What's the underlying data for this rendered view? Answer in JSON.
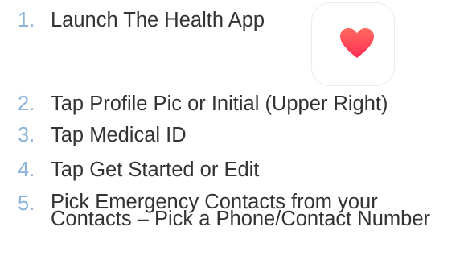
{
  "steps": [
    {
      "number": "1.",
      "text": "Launch The Health App"
    },
    {
      "number": "2.",
      "text": "Tap Profile Pic or Initial (Upper Right)"
    },
    {
      "number": "3.",
      "text": "Tap Medical ID"
    },
    {
      "number": "4.",
      "text": "Tap Get Started or Edit"
    },
    {
      "number": "5.",
      "text": "Pick Emergency Contacts from your Contacts – Pick a Phone/Contact Number"
    }
  ],
  "colors": {
    "number": "#8cb3d9",
    "text": "#333333",
    "heart_top": "#ff6a5e",
    "heart_bottom": "#ff2d55"
  },
  "icon": {
    "name": "health-app-heart-icon"
  }
}
